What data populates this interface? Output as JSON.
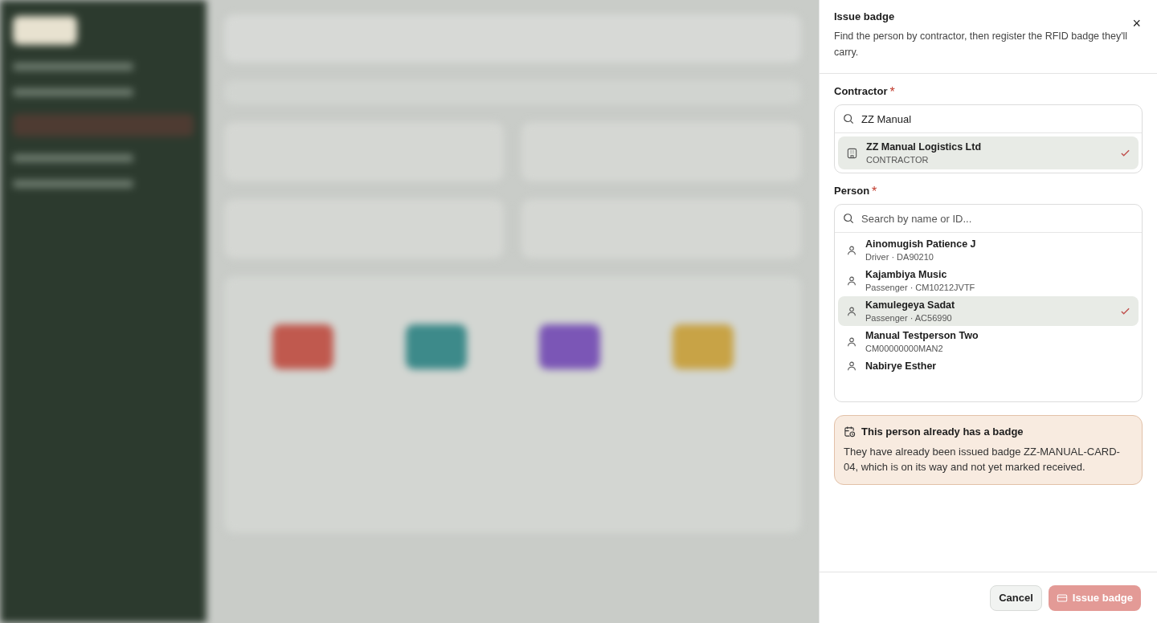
{
  "drawer": {
    "title": "Issue badge",
    "subtitle": "Find the person by contractor, then register the RFID badge they'll carry.",
    "close": "×"
  },
  "contractor": {
    "label": "Contractor",
    "required_mark": "*",
    "search": {
      "value": "ZZ Manual"
    },
    "options": [
      {
        "name": "ZZ Manual Logistics Ltd",
        "sub": "CONTRACTOR",
        "selected": true
      }
    ]
  },
  "person": {
    "label": "Person",
    "required_mark": "*",
    "search": {
      "placeholder": "Search by name or ID..."
    },
    "options": [
      {
        "name": "Ainomugish Patience J",
        "sub": "Driver · DA90210",
        "selected": false
      },
      {
        "name": "Kajambiya Music",
        "sub": "Passenger · CM10212JVTF",
        "selected": false
      },
      {
        "name": "Kamulegeya Sadat",
        "sub": "Passenger · AC56990",
        "selected": true
      },
      {
        "name": "Manual Testperson Two",
        "sub": "CM00000000MAN2",
        "selected": false
      },
      {
        "name": "Nabirye Esther",
        "selected": false
      }
    ]
  },
  "notice": {
    "title": "This person already has a badge",
    "body": "They have already been issued badge ZZ-MANUAL-CARD-04, which is on its way and not yet marked received."
  },
  "buttons": [
    {
      "kind": "cancel",
      "label": "Cancel",
      "disabled": false
    },
    {
      "kind": "issue",
      "label": "Issue badge",
      "disabled": true
    }
  ]
}
